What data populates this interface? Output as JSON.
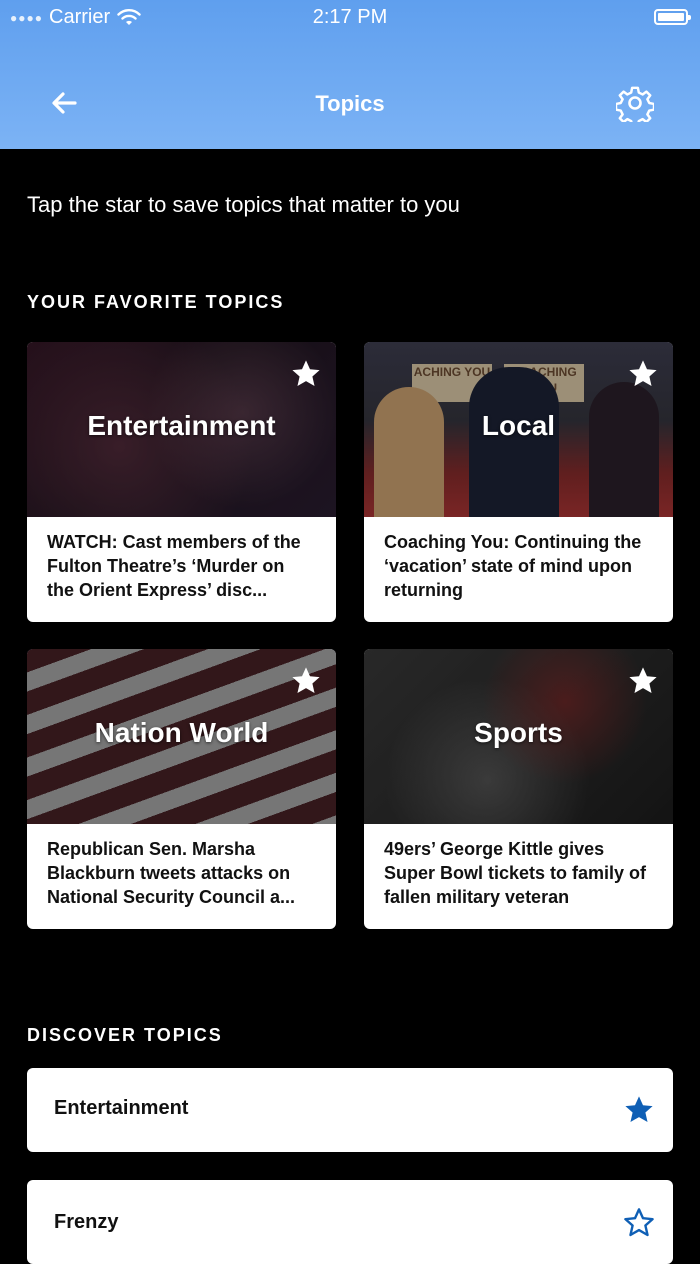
{
  "status_bar": {
    "carrier": "Carrier",
    "time": "2:17 PM"
  },
  "nav": {
    "title": "Topics"
  },
  "intro": "Tap the star to save topics that matter to you",
  "favorites": {
    "title": "YOUR FAVORITE TOPICS",
    "cards": [
      {
        "topic": "Entertainment",
        "headline": "WATCH: Cast members of the Fulton Theatre’s ‘Murder on the Orient Express’ disc...",
        "starred": true
      },
      {
        "topic": "Local",
        "headline": "Coaching You: Continuing the ‘vacation’ state of mind upon returning",
        "starred": true,
        "sign_left": "ACHING YOU",
        "sign_right": "COACHING YOU"
      },
      {
        "topic": "Nation World",
        "headline": "Republican Sen. Marsha Blackburn tweets attacks on National Security Council a...",
        "starred": true
      },
      {
        "topic": "Sports",
        "headline": "49ers’ George Kittle gives Super Bowl tickets to family of fallen military veteran",
        "starred": true
      }
    ]
  },
  "discover": {
    "title": "DISCOVER TOPICS",
    "items": [
      {
        "label": "Entertainment",
        "starred": true
      },
      {
        "label": "Frenzy",
        "starred": false
      }
    ]
  },
  "colors": {
    "header": "#6aa7f0",
    "star_active": "#0f5fb5",
    "background": "#000000"
  }
}
